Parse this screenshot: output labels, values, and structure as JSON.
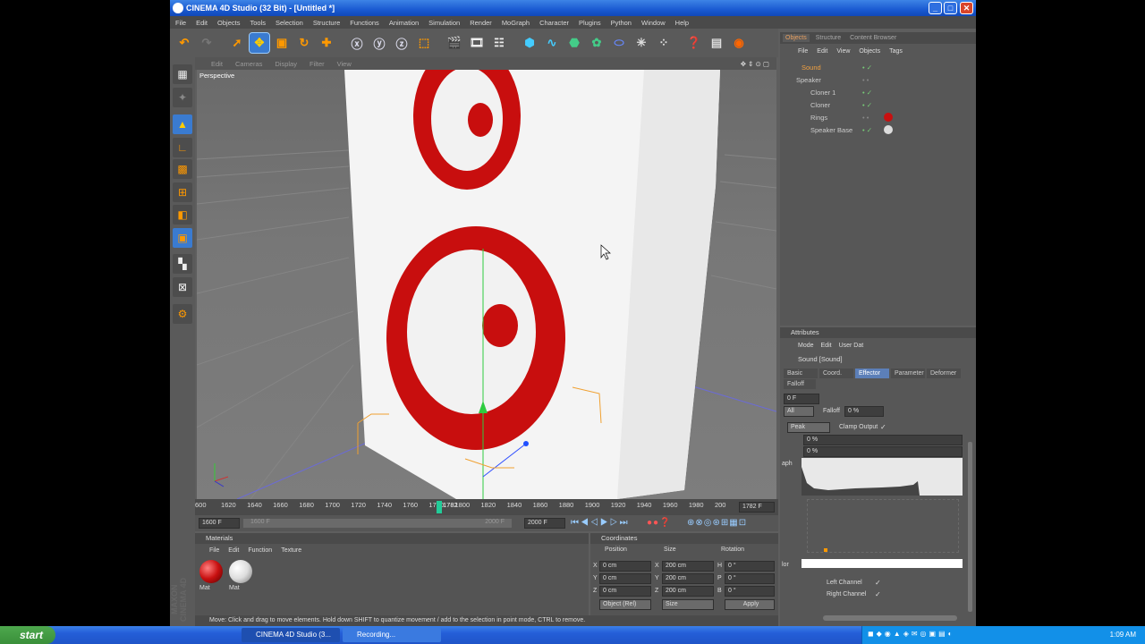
{
  "window": {
    "title": "CINEMA 4D Studio (32 Bit) - [Untitled *]"
  },
  "menubar": [
    "File",
    "Edit",
    "Objects",
    "Tools",
    "Selection",
    "Structure",
    "Functions",
    "Animation",
    "Simulation",
    "Render",
    "MoGraph",
    "Character",
    "Plugins",
    "Python",
    "Window",
    "Help"
  ],
  "viewport": {
    "menu": [
      "Edit",
      "Cameras",
      "Display",
      "Filter",
      "View"
    ],
    "label": "Perspective"
  },
  "timeline": {
    "ticks": [
      "600",
      "1620",
      "1640",
      "1660",
      "1680",
      "1700",
      "1720",
      "1740",
      "1760",
      "1780",
      "1800",
      "1820",
      "1840",
      "1860",
      "1880",
      "1900",
      "1920",
      "1940",
      "1960",
      "1980",
      "200"
    ],
    "current_marker": "1782",
    "current_frame_field": "1782 F",
    "start_field": "1600 F",
    "range_start": "1600 F",
    "range_end": "2000 F",
    "end_field": "2000 F"
  },
  "materials": {
    "header": "Materials",
    "menu": [
      "File",
      "Edit",
      "Function",
      "Texture"
    ],
    "items": [
      {
        "label": "Mat",
        "color": "#c81010"
      },
      {
        "label": "Mat",
        "color": "#e0e0e0"
      }
    ]
  },
  "coordinates": {
    "header": "Coordinates",
    "col_headers": [
      "Position",
      "Size",
      "Rotation"
    ],
    "rows": [
      {
        "axis": "X",
        "pos": "0 cm",
        "size_axis": "X",
        "size": "200 cm",
        "rot_axis": "H",
        "rot": "0 °"
      },
      {
        "axis": "Y",
        "pos": "0 cm",
        "size_axis": "Y",
        "size": "200 cm",
        "rot_axis": "P",
        "rot": "0 °"
      },
      {
        "axis": "Z",
        "pos": "0 cm",
        "size_axis": "Z",
        "size": "200 cm",
        "rot_axis": "B",
        "rot": "0 °"
      }
    ],
    "mode_select": "Object (Rel)",
    "size_select": "Size",
    "apply_label": "Apply"
  },
  "statusbar": {
    "text": "Move: Click and drag to move elements. Hold down SHIFT to quantize movement / add to the selection in point mode, CTRL to remove."
  },
  "objects_panel": {
    "tabs": [
      "Objects",
      "Structure",
      "Content Browser"
    ],
    "menu": [
      "File",
      "Edit",
      "View",
      "Objects",
      "Tags"
    ],
    "items": [
      {
        "name": "Sound",
        "highlight": true
      },
      {
        "name": "Speaker",
        "highlight": false
      },
      {
        "name": "Cloner 1",
        "highlight": false
      },
      {
        "name": "Cloner",
        "highlight": false
      },
      {
        "name": "Rings",
        "highlight": false
      },
      {
        "name": "Speaker Base",
        "highlight": false
      }
    ]
  },
  "attributes": {
    "header": "Attributes",
    "menu": [
      "Mode",
      "Edit",
      "User Dat"
    ],
    "object_title": "Sound [Sound]",
    "tabs": [
      "Basic",
      "Coord.",
      "Effector",
      "Parameter",
      "Deformer",
      "Falloff"
    ],
    "active_tab": "Effector",
    "frame_field": "0 F",
    "all_select": "All",
    "falloff_label": "Falloff",
    "falloff_value": "0 %",
    "peak_select": "Peak",
    "clamp_label": "Clamp Output",
    "pct1": "0 %",
    "pct2": "0 %",
    "graph_label": "aph",
    "color_label": "lor",
    "left_channel": "Left Channel",
    "right_channel": "Right Channel"
  },
  "taskbar": {
    "start": "start",
    "tasks": [
      "CINEMA 4D Studio (3...",
      "Recording..."
    ],
    "clock": "1:09 AM"
  },
  "maxon": "MAXON CINEMA 4D"
}
